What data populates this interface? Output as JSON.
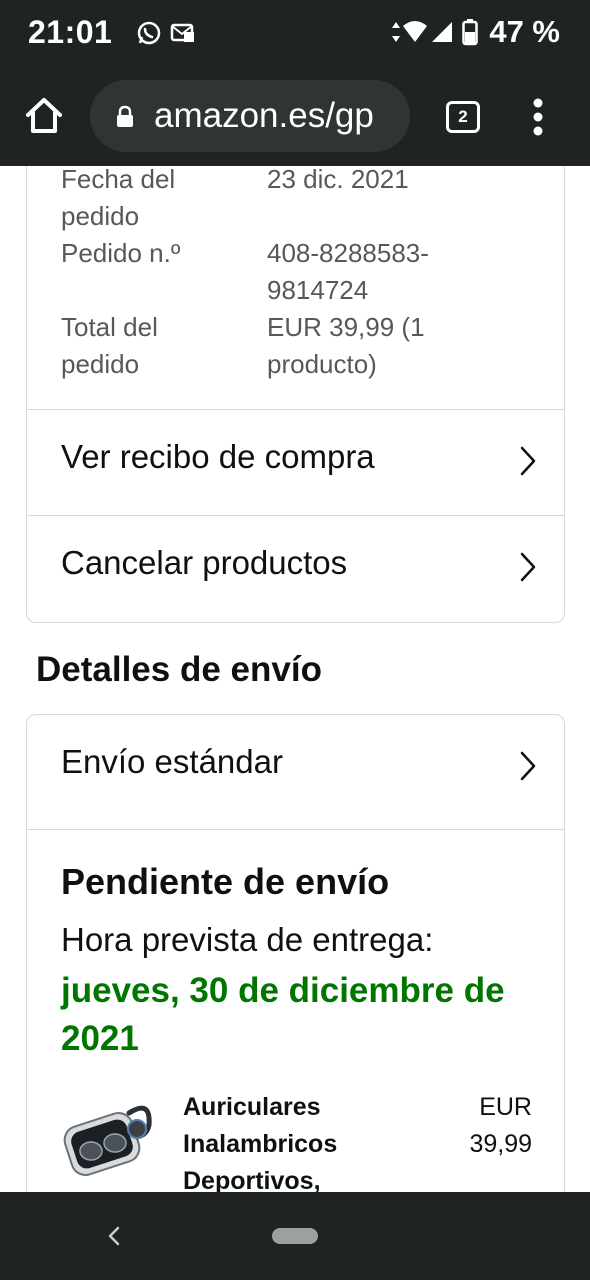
{
  "status_bar": {
    "time": "21:01",
    "icons": [
      "whatsapp-icon",
      "message-icon",
      "data-arrows-icon",
      "wifi-icon",
      "signal-icon",
      "battery-icon"
    ],
    "battery": "47 %"
  },
  "browser": {
    "url": "amazon.es/gp",
    "tab_count": "2",
    "icons": [
      "home-icon",
      "lock-icon",
      "tabs-icon",
      "more-menu-icon"
    ]
  },
  "order_summary": {
    "rows": [
      {
        "label_line1": "Fecha del",
        "label_line2": "pedido",
        "value_line1": "23 dic. 2021",
        "value_line2": ""
      },
      {
        "label_line1": "Pedido n.º",
        "label_line2": "",
        "value_line1": "408-8288583-",
        "value_line2": "9814724"
      },
      {
        "label_line1": "Total del",
        "label_line2": "pedido",
        "value_line1": "EUR 39,99 (1",
        "value_line2": "producto)"
      }
    ],
    "links": [
      {
        "label": "Ver recibo de compra"
      },
      {
        "label": "Cancelar productos"
      }
    ]
  },
  "shipping": {
    "section_title": "Detalles de envío",
    "method": "Envío estándar",
    "status": "Pendiente de envío",
    "eta_label": "Hora prevista de entrega:",
    "eta_date": "jueves, 30 de diciembre de 2021",
    "eta_color": "#007600",
    "product": {
      "name_line1": "Auriculares",
      "name_line2": "Inalambricos",
      "name_line3": "Deportivos,",
      "price_line1": "EUR",
      "price_line2": "39,99"
    }
  },
  "system_nav": {
    "icons": [
      "back-icon",
      "home-pill"
    ]
  }
}
